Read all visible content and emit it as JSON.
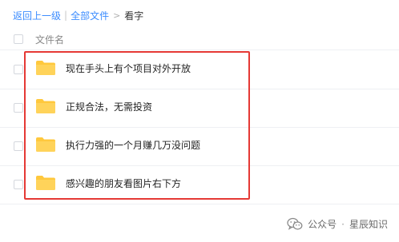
{
  "breadcrumb": {
    "back_label": "返回上一级",
    "separator": "|",
    "all_files_label": "全部文件",
    "arrow": ">",
    "current_label": "看字"
  },
  "list_header": {
    "name_column": "文件名"
  },
  "files": [
    {
      "name": "现在手头上有个项目对外开放",
      "icon": "folder-icon"
    },
    {
      "name": "正规合法，无需投资",
      "icon": "folder-icon"
    },
    {
      "name": "执行力强的一个月赚几万没问题",
      "icon": "folder-icon"
    },
    {
      "name": "感兴趣的朋友看图片右下方",
      "icon": "folder-icon"
    }
  ],
  "watermark": {
    "icon": "wechat-icon",
    "left_text": "公众号",
    "separator": "·",
    "right_text": "星辰知识"
  },
  "colors": {
    "link": "#3b8cff",
    "highlight": "#e53935",
    "folder": "#ffc83d"
  }
}
